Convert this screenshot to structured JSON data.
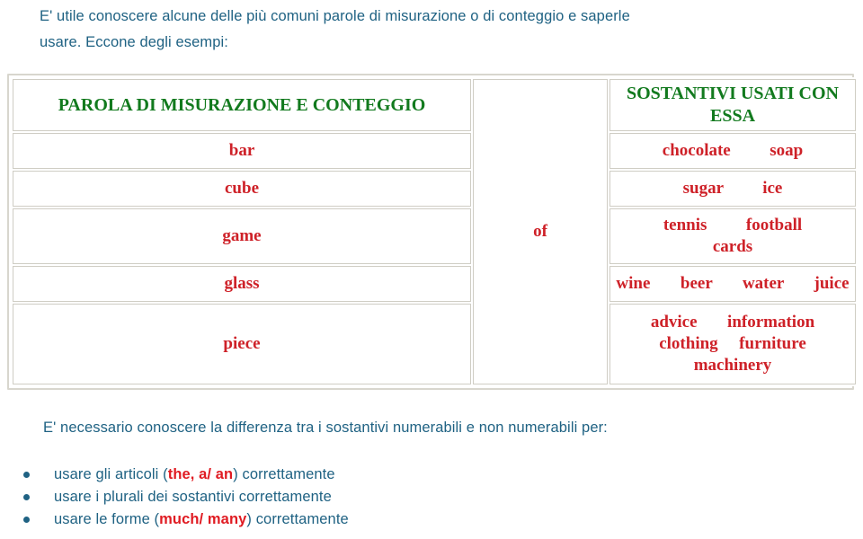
{
  "intro": {
    "line1": "E' utile conoscere alcune delle più comuni parole di misurazione o di conteggio e saperle",
    "line2": "usare. Eccone degli esempi:"
  },
  "table": {
    "headers": {
      "left": "PAROLA DI MISURAZIONE E CONTEGGIO",
      "middle": "of",
      "right": "SOSTANTIVI USATI CON ESSA"
    },
    "rows": [
      {
        "word": "bar",
        "nouns": [
          "chocolate",
          "soap"
        ]
      },
      {
        "word": "cube",
        "nouns": [
          "sugar",
          "ice"
        ]
      },
      {
        "word": "game",
        "nouns": [
          "tennis",
          "football",
          "cards"
        ]
      },
      {
        "word": "glass",
        "nouns": [
          "wine",
          "beer",
          "water",
          "juice"
        ]
      },
      {
        "word": "piece",
        "nouns": [
          "advice",
          "information",
          "clothing",
          "furniture",
          "machinery"
        ]
      }
    ],
    "cells": {
      "nouns_bar": "chocolate",
      "nouns_bar_2": "soap",
      "nouns_cube": "sugar",
      "nouns_cube_2": "ice",
      "nouns_game_1": "tennis",
      "nouns_game_2": "football",
      "nouns_game_3": "cards",
      "nouns_glass_1": "wine",
      "nouns_glass_2": "beer",
      "nouns_glass_3": "water",
      "nouns_glass_4": "juice",
      "nouns_piece_1": "advice",
      "nouns_piece_2": "information",
      "nouns_piece_3": "clothing",
      "nouns_piece_4": "furniture",
      "nouns_piece_5": "machinery"
    }
  },
  "outro": {
    "text": "E' necessario conoscere la differenza tra i sostantivi numerabili e non numerabili per:"
  },
  "tips": {
    "item1_pre": "usare gli articoli (",
    "item1_em": "the, a/ an",
    "item1_post": ") correttamente",
    "item2": "usare i plurali dei sostantivi correttamente",
    "item3_pre": "usare le forme (",
    "item3_em": "much/ many",
    "item3_post": ") correttamente"
  },
  "colors": {
    "text_blue": "#1F6283",
    "word_red": "#CE2128",
    "header_green": "#127A1E",
    "emphasis_red": "#E01B22",
    "table_border": "#D8D6CE",
    "cell_border": "#CFCDC4"
  }
}
